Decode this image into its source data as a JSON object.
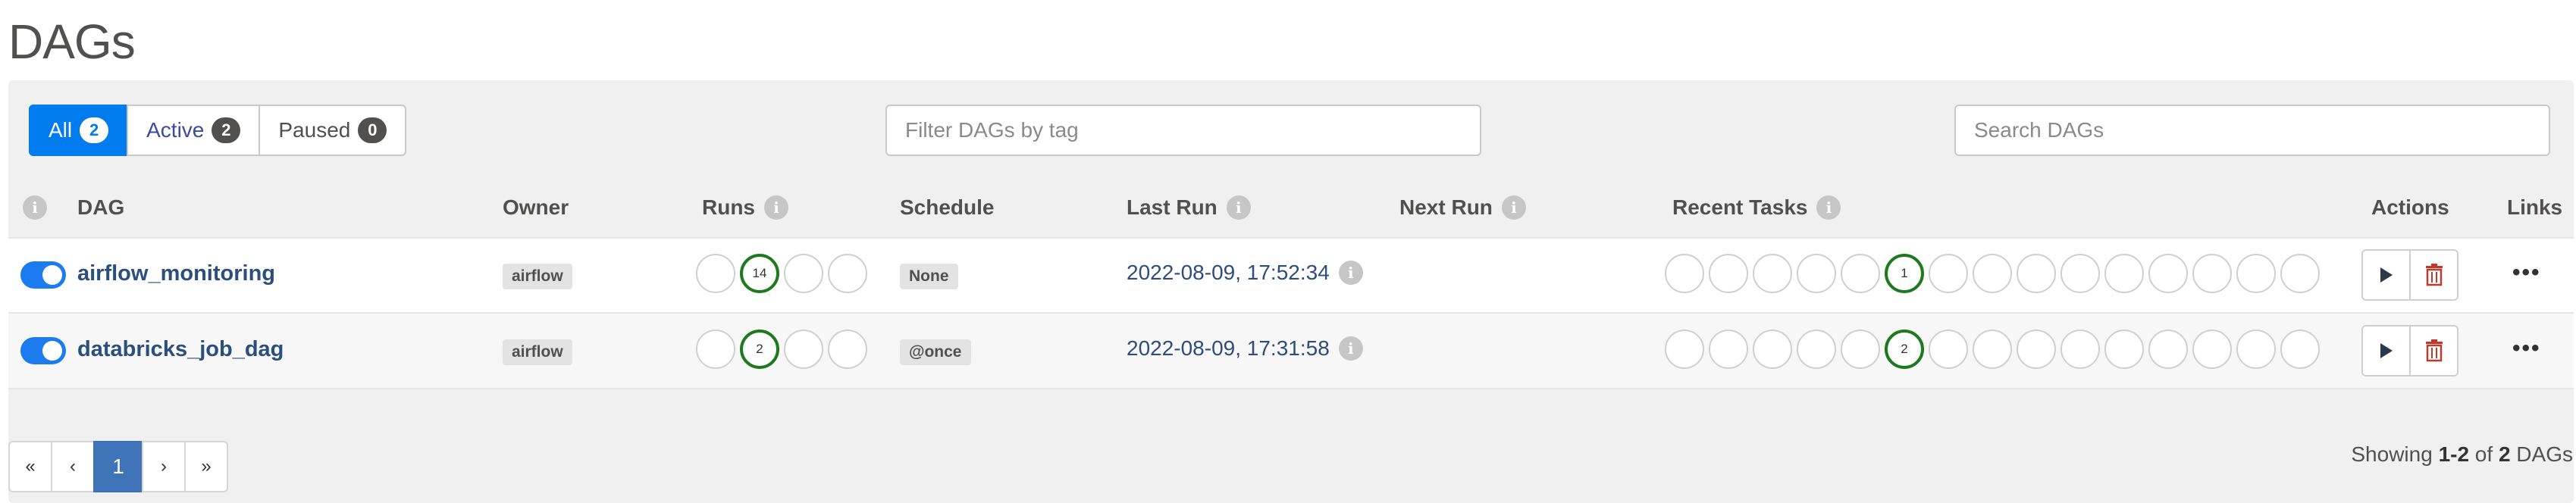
{
  "page": {
    "title": "DAGs"
  },
  "filters": [
    {
      "label": "All",
      "count": "2",
      "active": true
    },
    {
      "label": "Active",
      "count": "2",
      "active": false
    },
    {
      "label": "Paused",
      "count": "0",
      "active": false
    }
  ],
  "tag_filter": {
    "placeholder": "Filter DAGs by tag",
    "value": ""
  },
  "search": {
    "placeholder": "Search DAGs",
    "value": ""
  },
  "columns": {
    "dag": "DAG",
    "owner": "Owner",
    "runs": "Runs",
    "schedule": "Schedule",
    "last_run": "Last Run",
    "next_run": "Next Run",
    "recent_tasks": "Recent Tasks",
    "actions": "Actions",
    "links": "Links"
  },
  "icons": {
    "info": "info-icon",
    "toggle": "toggle-switch",
    "trigger": "play-icon",
    "delete": "trash-icon",
    "more": "ellipsis-icon"
  },
  "colors": {
    "accent": "#017cee",
    "success": "#1f7a1f",
    "delete": "#c0392b",
    "link": "#2a4f7d"
  },
  "rows": [
    {
      "dag_id": "airflow_monitoring",
      "paused": false,
      "owner": "airflow",
      "runs": [
        "",
        "14",
        "",
        ""
      ],
      "schedule": "None",
      "last_run": "2022-08-09, 17:52:34",
      "next_run": "",
      "recent_tasks": [
        "",
        "",
        "",
        "",
        "",
        "1",
        "",
        "",
        "",
        "",
        "",
        "",
        "",
        "",
        ""
      ],
      "more": "•••"
    },
    {
      "dag_id": "databricks_job_dag",
      "paused": false,
      "owner": "airflow",
      "runs": [
        "",
        "2",
        "",
        ""
      ],
      "schedule": "@once",
      "last_run": "2022-08-09, 17:31:58",
      "next_run": "",
      "recent_tasks": [
        "",
        "",
        "",
        "",
        "",
        "2",
        "",
        "",
        "",
        "",
        "",
        "",
        "",
        "",
        ""
      ],
      "more": "•••"
    }
  ],
  "pagination": {
    "first": "«",
    "prev": "‹",
    "current": "1",
    "next": "›",
    "last": "»"
  },
  "showing": {
    "prefix": "Showing ",
    "range": "1-2",
    "of": " of ",
    "total": "2",
    "suffix": " DAGs"
  }
}
